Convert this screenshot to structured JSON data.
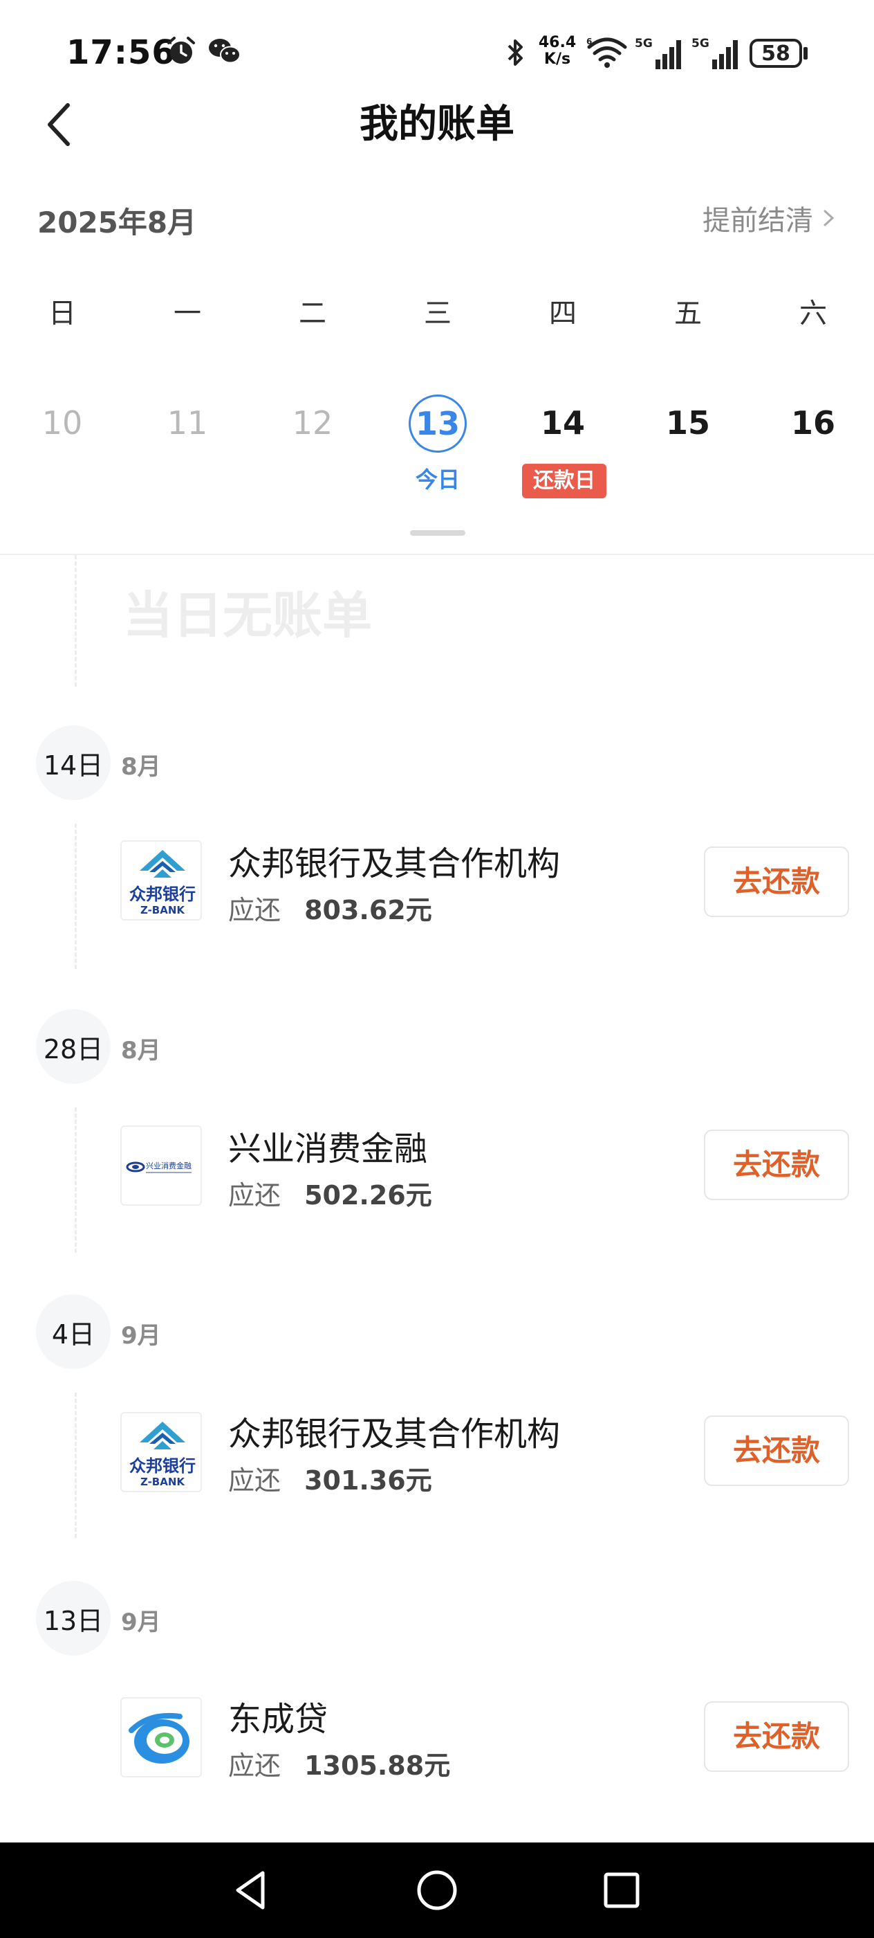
{
  "status_bar": {
    "time": "17:56",
    "net_speed_value": "46.4",
    "net_speed_unit": "K/s",
    "battery": "58",
    "icons": [
      "alarm-icon",
      "wechat-icon",
      "bluetooth-icon",
      "wifi-icon",
      "signal-5g-icon",
      "signal-5g-icon",
      "battery-icon"
    ]
  },
  "header": {
    "title": "我的账单",
    "back_icon": "chevron-left-icon"
  },
  "month_bar": {
    "month": "2025年8月",
    "settle_label": "提前结清"
  },
  "calendar": {
    "weekdays": [
      "日",
      "一",
      "二",
      "三",
      "四",
      "五",
      "六"
    ],
    "days": [
      "10",
      "11",
      "12",
      "13",
      "14",
      "15",
      "16"
    ],
    "today_label": "今日",
    "due_badge": "还款日",
    "today_color": "#3a86e8",
    "badge_color": "#ea5b4c"
  },
  "empty_state": "当日无账单",
  "groups": [
    {
      "day": "14日",
      "month": "8月",
      "bill": {
        "name": "众邦银行及其合作机构",
        "amount_label": "应还",
        "amount": "803.62元",
        "logo": "zbank-logo",
        "logo_text": "众邦银行",
        "logo_subtext": "Z-BANK",
        "pay_label": "去还款"
      }
    },
    {
      "day": "28日",
      "month": "8月",
      "bill": {
        "name": "兴业消费金融",
        "amount_label": "应还",
        "amount": "502.26元",
        "logo": "xingye-logo",
        "logo_text": "兴业消费金融",
        "pay_label": "去还款"
      }
    },
    {
      "day": "4日",
      "month": "9月",
      "bill": {
        "name": "众邦银行及其合作机构",
        "amount_label": "应还",
        "amount": "301.36元",
        "logo": "zbank-logo",
        "logo_text": "众邦银行",
        "logo_subtext": "Z-BANK",
        "pay_label": "去还款"
      }
    },
    {
      "day": "13日",
      "month": "9月",
      "bill": {
        "name": "东成贷",
        "amount_label": "应还",
        "amount": "1305.88元",
        "logo": "dongchengdai-logo",
        "pay_label": "去还款"
      }
    }
  ],
  "accent_colors": {
    "pay_button_text": "#e0602a"
  },
  "nav_bar": {
    "icons": [
      "back-triangle-icon",
      "home-circle-icon",
      "recents-square-icon"
    ]
  }
}
